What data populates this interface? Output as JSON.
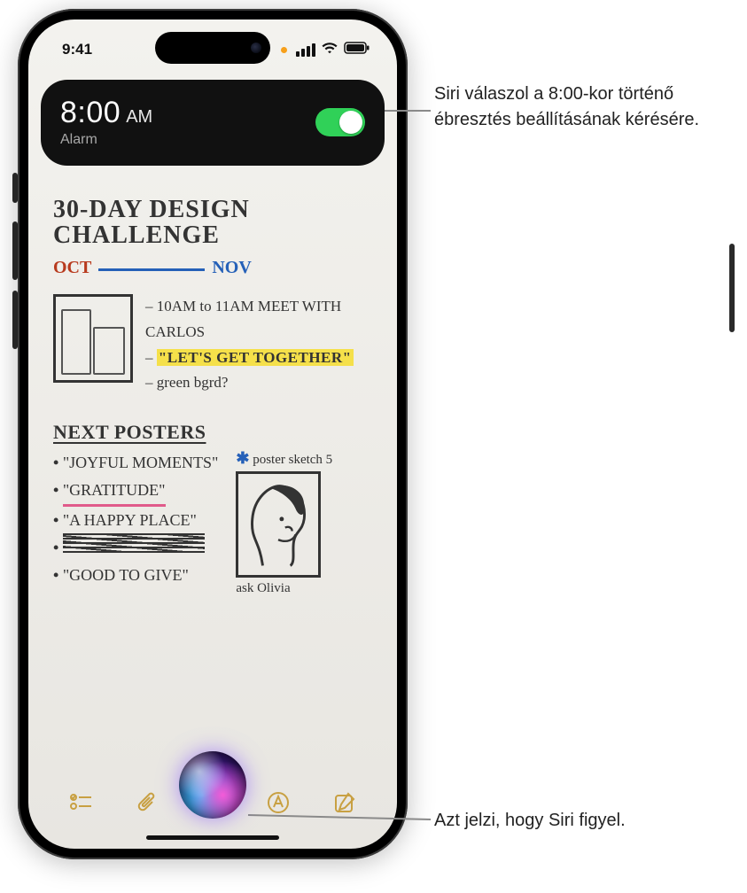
{
  "status": {
    "time": "9:41"
  },
  "siri_card": {
    "time": "8:00",
    "ampm": "AM",
    "label": "Alarm",
    "toggle_on": true
  },
  "note": {
    "title_line1": "30-DAY DESIGN",
    "title_line2": "CHALLENGE",
    "month_oct": "OCT",
    "month_nov": "NOV",
    "bullets": {
      "b1": "10AM to 11AM MEET WITH CARLOS",
      "b2": "\"LET'S GET TOGETHER\"",
      "b3": "green bgrd?"
    },
    "posters_title": "NEXT POSTERS",
    "posters": {
      "p1": "\"JOYFUL MOMENTS\"",
      "p2": "\"GRATITUDE\"",
      "p3": "\"A HAPPY PLACE\"",
      "p4_struck": "(scribbled out)",
      "p5": "\"GOOD TO GIVE\""
    },
    "sketch_label": "poster sketch 5",
    "ask": "ask Olivia"
  },
  "callouts": {
    "c1": "Siri válaszol a 8:00-kor történő ébresztés beállításának kérésére.",
    "c2": "Azt jelzi, hogy Siri figyel."
  }
}
